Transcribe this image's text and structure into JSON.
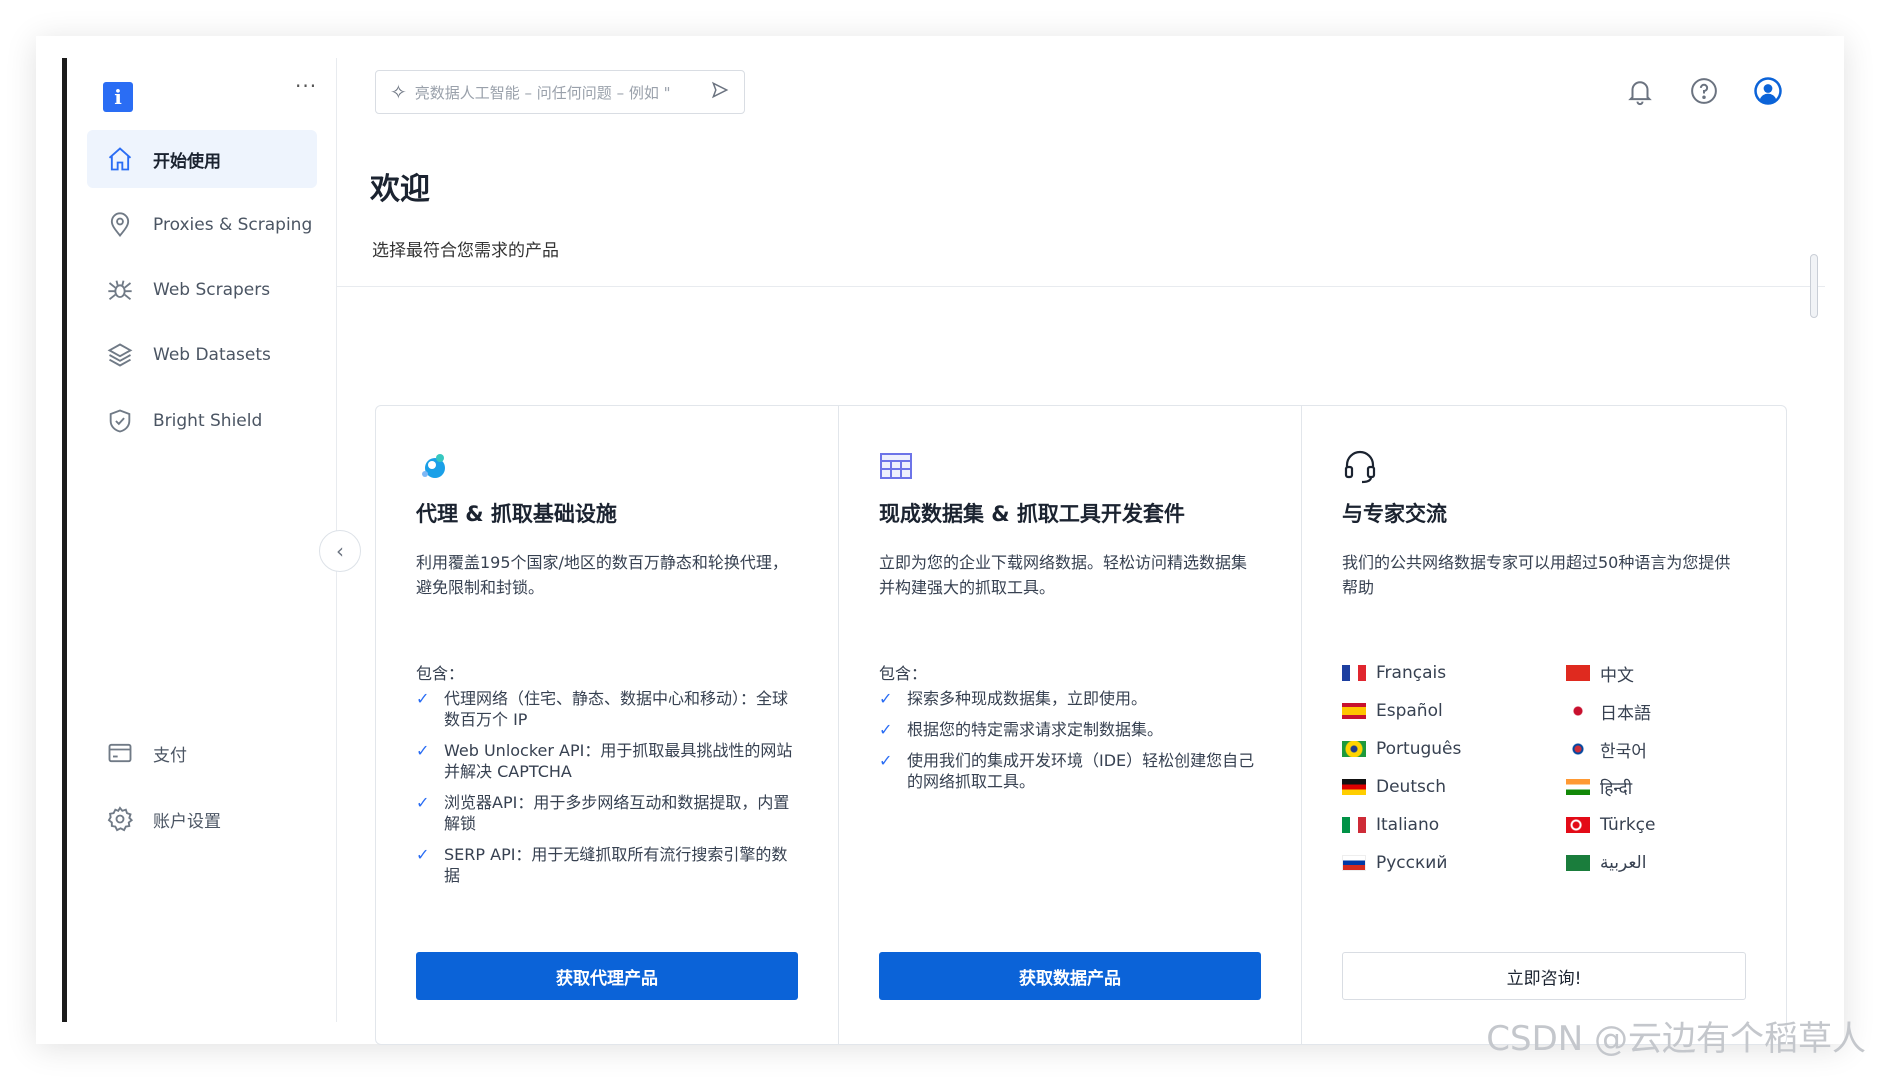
{
  "sidebar": {
    "logo_letter": "i",
    "more": "···",
    "items": [
      {
        "label": "开始使用",
        "icon": "home-icon"
      },
      {
        "label": "Proxies & Scraping",
        "icon": "location-pin-icon"
      },
      {
        "label": "Web Scrapers",
        "icon": "spider-icon"
      },
      {
        "label": "Web Datasets",
        "icon": "layers-icon"
      },
      {
        "label": "Bright Shield",
        "icon": "shield-icon"
      }
    ],
    "bottom_items": [
      {
        "label": "支付",
        "icon": "credit-card-icon"
      },
      {
        "label": "账户设置",
        "icon": "gear-icon"
      }
    ]
  },
  "topbar": {
    "search_placeholder": "亮数据人工智能 – 问任何问题 – 例如 \"",
    "icons": [
      "bell-icon",
      "help-icon",
      "user-icon"
    ]
  },
  "header": {
    "title": "欢迎",
    "subtitle": "选择最符合您需求的产品"
  },
  "cards": [
    {
      "title": "代理 & 抓取基础设施",
      "desc": "利用覆盖195个国家/地区的数百万静态和轮换代理，避免限制和封锁。",
      "includes": "包含：",
      "features": [
        "代理网络（住宅、静态、数据中心和移动）：全球数百万个 IP",
        "Web Unlocker API：用于抓取最具挑战性的网站并解决 CAPTCHA",
        "浏览器API：用于多步网络互动和数据提取，内置解锁",
        "SERP API：用于无缝抓取所有流行搜索引擎的数据"
      ],
      "button": "获取代理产品"
    },
    {
      "title": "现成数据集 & 抓取工具开发套件",
      "desc": "立即为您的企业下载网络数据。轻松访问精选数据集并构建强大的抓取工具。",
      "includes": "包含：",
      "features": [
        "探索多种现成数据集，立即使用。",
        "根据您的特定需求请求定制数据集。",
        "使用我们的集成开发环境（IDE）轻松创建您自己的网络抓取工具。"
      ],
      "button": "获取数据产品"
    },
    {
      "title": "与专家交流",
      "desc": "我们的公共网络数据专家可以用超过50种语言为您提供帮助",
      "languages": [
        {
          "label": "Français",
          "flag": "fr"
        },
        {
          "label": "中文",
          "flag": "cn"
        },
        {
          "label": "Español",
          "flag": "es"
        },
        {
          "label": "日本語",
          "flag": "jp"
        },
        {
          "label": "Português",
          "flag": "br"
        },
        {
          "label": "한국어",
          "flag": "kr"
        },
        {
          "label": "Deutsch",
          "flag": "de"
        },
        {
          "label": "हिन्दी",
          "flag": "in"
        },
        {
          "label": "Italiano",
          "flag": "it"
        },
        {
          "label": "Türkçe",
          "flag": "tr"
        },
        {
          "label": "Русский",
          "flag": "ru"
        },
        {
          "label": "العربية",
          "flag": "sa"
        }
      ],
      "button": "立即咨询!"
    }
  ],
  "watermark": "CSDN @云边有个稻草人",
  "colors": {
    "accent": "#2a6df4",
    "button": "#0b63d8"
  }
}
